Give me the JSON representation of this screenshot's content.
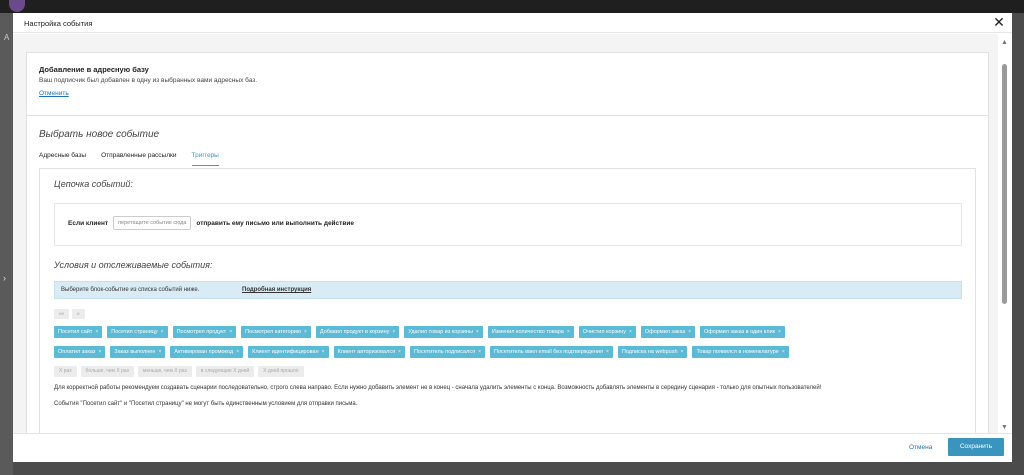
{
  "modal": {
    "title": "Настройка события",
    "close_label": "✕"
  },
  "background": {
    "letter": "A",
    "expand_arrow": "›"
  },
  "info": {
    "title": "Добавление в адресную базу",
    "text": "Ваш подписчик был добавлен в одну из выбранных вами адресных баз.",
    "cancel_link": "Отменить"
  },
  "section": {
    "title": "Выбрать новое событие",
    "tabs": [
      {
        "label": "Адресные базы",
        "active": false
      },
      {
        "label": "Отправленные рассылки",
        "active": false
      },
      {
        "label": "Триггеры",
        "active": true
      }
    ]
  },
  "chain": {
    "title": "Цепочка событий:",
    "prefix": "Если клиент",
    "drop_placeholder": "перетащите событие сюда",
    "suffix": "отправить ему письмо или выполнить действие"
  },
  "conditions": {
    "title": "Условия и отслеживаемые события:",
    "hint": "Выберите блок-событие из списка событий ниже.",
    "hint_link": "Подробная инструкция",
    "logic_ops": [
      "не",
      "и"
    ],
    "events_row1": [
      "Посетил сайт",
      "Посетил страницу",
      "Посмотрел продукт",
      "Посмотрел категорию",
      "Добавил продукт в корзину",
      "Удалил товар из корзины",
      "Изменил количество товара",
      "Очистил корзину",
      "Оформил заказ",
      "Оформил заказ в один клик"
    ],
    "events_row2": [
      "Оплатил заказ",
      "Заказ выполнен",
      "Активирован промокод",
      "Клиент идентифицирован",
      "Клиент авторизовался",
      "Посетитель подписался",
      "Посетитель ввел email без подтверждения",
      "Подписка на webpush",
      "Товар появился в номенклатуре"
    ],
    "condition_ops": [
      "X раз",
      "больше, чем X раз",
      "меньше, чем X раз",
      "в следующие X дней",
      "X дней прошло"
    ],
    "remove_symbol": "×",
    "note1": "Для корректной работы рекомендуем создавать сценарии последовательно, строго слева направо. Если нужно добавить элемент не в конец - сначала удалить элементы с конца. Возможность добавлять элементы в середину сценария - только для опытных пользователей!",
    "note2": "События \"Посетил сайт\" и \"Посетил страницу\" не могут быть единственным условием для отправки письма."
  },
  "footer": {
    "cancel": "Отмена",
    "save": "Сохранить"
  },
  "colors": {
    "accent": "#3a95be",
    "tag": "#5bbad5",
    "hint_bg": "#d9ecf5"
  },
  "scroll": {
    "up": "▲",
    "down": "▼"
  }
}
